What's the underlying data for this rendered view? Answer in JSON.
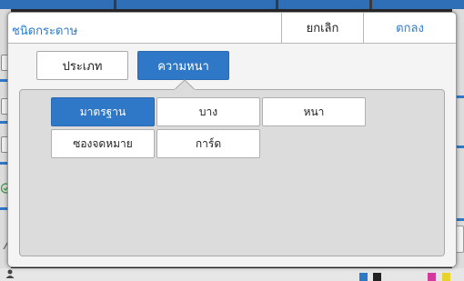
{
  "dialog": {
    "title": "ชนิดกระดาษ",
    "cancel_label": "ยกเลิก",
    "ok_label": "ตกลง"
  },
  "tabs": [
    {
      "label": "ประเภท",
      "active": false
    },
    {
      "label": "ความหนา",
      "active": true
    }
  ],
  "thickness_options": [
    {
      "label": "มาตรฐาน",
      "selected": true
    },
    {
      "label": "บาง",
      "selected": false
    },
    {
      "label": "หนา",
      "selected": false
    },
    {
      "label": "ซองจดหมาย",
      "selected": false
    },
    {
      "label": "การ์ด",
      "selected": false
    }
  ],
  "colors": {
    "accent": "#2f78c8",
    "title_text": "#2a7bd0",
    "panel_bg": "#dcdcdc",
    "dialog_bg": "#f4f4f4"
  }
}
